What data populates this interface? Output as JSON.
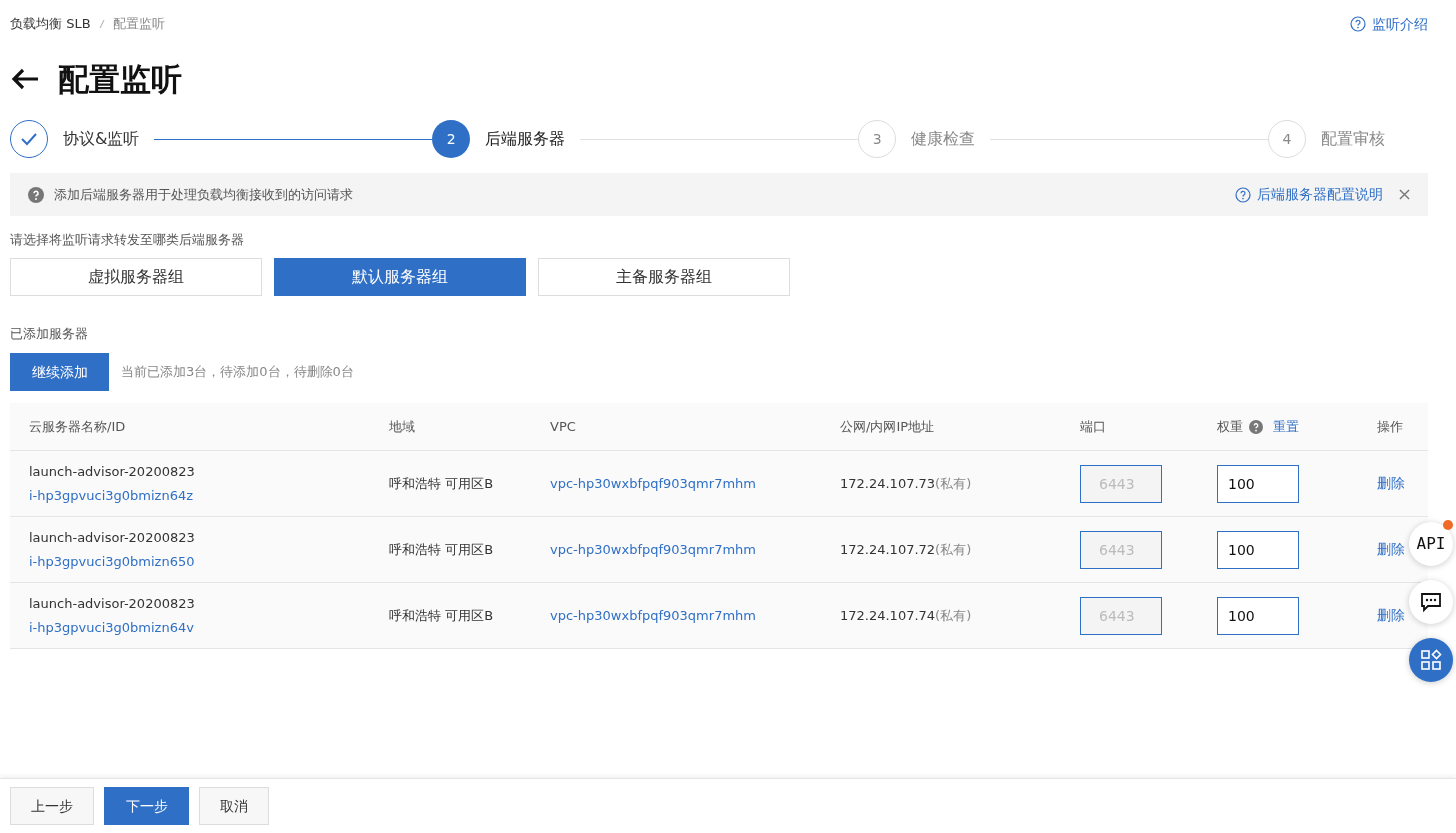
{
  "breadcrumb": [
    "负载均衡 SLB",
    "配置监听"
  ],
  "help_link": "监听介绍",
  "title": "配置监听",
  "steps": [
    {
      "label": "协议&监听",
      "completed": true,
      "current": false
    },
    {
      "number": "2",
      "label": "后端服务器",
      "completed": false,
      "current": true
    },
    {
      "number": "3",
      "label": "健康检查",
      "completed": false,
      "current": false
    },
    {
      "number": "4",
      "label": "配置审核",
      "completed": false,
      "current": false
    }
  ],
  "notice": {
    "text": "添加后端服务器用于处理负载均衡接收到的访问请求",
    "link": "后端服务器配置说明"
  },
  "group_prompt": "请选择将监听请求转发至哪类后端服务器",
  "group_tabs": [
    {
      "label": "虚拟服务器组",
      "selected": false
    },
    {
      "label": "默认服务器组",
      "selected": true
    },
    {
      "label": "主备服务器组",
      "selected": false
    }
  ],
  "added_title": "已添加服务器",
  "add_button": "继续添加",
  "add_summary": "当前已添加3台，待添加0台，待删除0台",
  "table": {
    "columns": [
      "云服务器名称/ID",
      "地域",
      "VPC",
      "公网/内网IP地址",
      "端口",
      "权重",
      "操作"
    ],
    "weight_reset": "重置",
    "rows": [
      {
        "name": "launch-advisor-20200823",
        "id": "i-hp3gpvuci3g0bmizn64z",
        "region": "呼和浩特 可用区B",
        "vpc": "vpc-hp30wxbfpqf903qmr7mhm",
        "ip": "172.24.107.73",
        "ip_type": "(私有)",
        "port": "6443",
        "port_disabled": true,
        "weight": "100",
        "action": "删除"
      },
      {
        "name": "launch-advisor-20200823",
        "id": "i-hp3gpvuci3g0bmizn650",
        "region": "呼和浩特 可用区B",
        "vpc": "vpc-hp30wxbfpqf903qmr7mhm",
        "ip": "172.24.107.72",
        "ip_type": "(私有)",
        "port": "6443",
        "port_disabled": true,
        "weight": "100",
        "action": "删除"
      },
      {
        "name": "launch-advisor-20200823",
        "id": "i-hp3gpvuci3g0bmizn64v",
        "region": "呼和浩特 可用区B",
        "vpc": "vpc-hp30wxbfpqf903qmr7mhm",
        "ip": "172.24.107.74",
        "ip_type": "(私有)",
        "port": "6443",
        "port_disabled": true,
        "weight": "100",
        "action": "删除"
      }
    ]
  },
  "float_buttons": [
    {
      "kind": "api",
      "label": "API",
      "badge": true
    },
    {
      "kind": "chat",
      "badge": false
    },
    {
      "kind": "apps",
      "badge": false
    }
  ],
  "footer": [
    {
      "label": "上一步",
      "kind": "default"
    },
    {
      "label": "下一步",
      "kind": "primary"
    },
    {
      "label": "取消",
      "kind": "default"
    }
  ]
}
